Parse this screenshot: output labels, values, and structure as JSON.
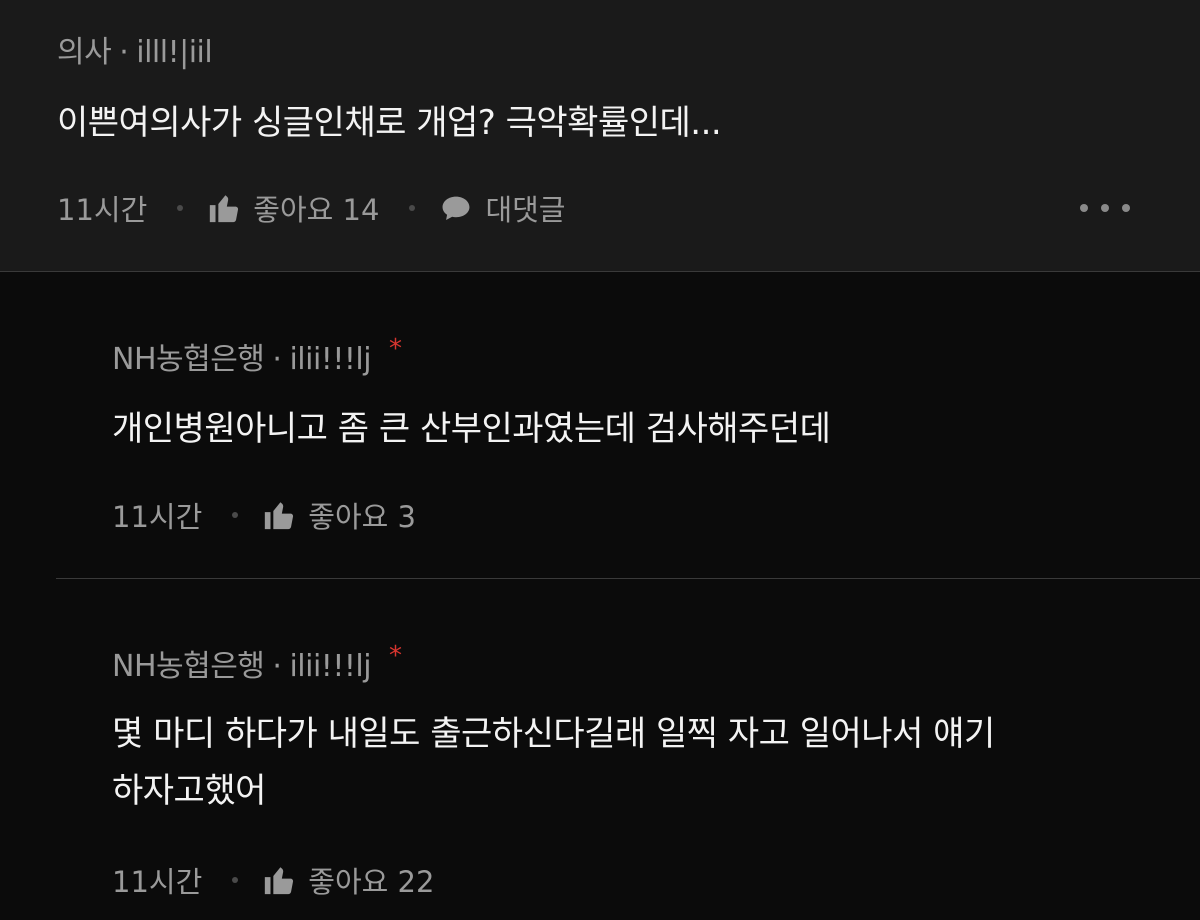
{
  "comment": {
    "author": "의사",
    "separator": "·",
    "user_id": "illl!|iil",
    "text": "이쁜여의사가 싱글인채로 개업? 극악확률인데...",
    "time": "11시간",
    "like_label": "좋아요 14",
    "reply_label": "대댓글"
  },
  "replies": [
    {
      "author": "NH농협은행",
      "separator": "·",
      "user_id": "ilii!!!lj",
      "op_marker": "*",
      "text": "개인병원아니고 좀 큰 산부인과였는데 검사해주던데",
      "time": "11시간",
      "like_label": "좋아요 3"
    },
    {
      "author": "NH농협은행",
      "separator": "·",
      "user_id": "ilii!!!lj",
      "op_marker": "*",
      "text_line1": "몇 마디 하다가 내일도 출근하신다길래 일찍 자고 일어나서 얘기",
      "text_line2": "하자고했어",
      "time": "11시간",
      "like_label": "좋아요 22"
    }
  ],
  "icons": {
    "like": "thumbs-up-icon",
    "reply": "speech-bubble-icon",
    "more": "more-icon"
  },
  "colors": {
    "background": "#0b0b0b",
    "top_comment_background": "#1a1a1a",
    "op_marker": "#d8352f"
  }
}
